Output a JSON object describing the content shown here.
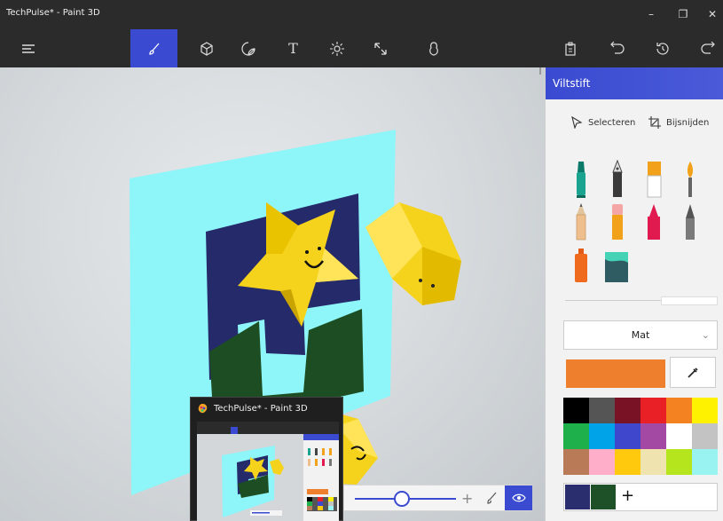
{
  "window": {
    "title": "TechPulse* - Paint 3D",
    "minimize": "–",
    "restore": "❐",
    "close": "✕"
  },
  "toolbar": {
    "menu_icon": "hamburger-icon",
    "tools": [
      {
        "name": "brushes",
        "icon": "brush-icon",
        "active": true
      },
      {
        "name": "3d-shapes",
        "icon": "cube-icon"
      },
      {
        "name": "stickers",
        "icon": "sticker-icon"
      },
      {
        "name": "text",
        "icon": "text-icon",
        "glyph": "T"
      },
      {
        "name": "effects",
        "icon": "sun-icon"
      },
      {
        "name": "canvas",
        "icon": "resize-icon"
      },
      {
        "name": "3d-library",
        "icon": "library-icon"
      }
    ],
    "right": [
      "paste-icon",
      "undo-icon",
      "history-icon",
      "redo-icon"
    ]
  },
  "panel": {
    "title": "Viltstift",
    "select_label": "Selecteren",
    "crop_label": "Bijsnijden",
    "brushes": [
      "marker",
      "calligraphy-pen",
      "oil-brush",
      "watercolor",
      "pencil",
      "eraser",
      "crayon",
      "pixel-pen",
      "spray-can",
      "fill"
    ],
    "finish_dropdown": "Mat",
    "current_color": "#ee7f2d",
    "palette": [
      "#000000",
      "#555555",
      "#7a1225",
      "#ea2027",
      "#f58220",
      "#fff200",
      "#1eb14b",
      "#00a2e8",
      "#3f48cc",
      "#a349a4",
      "#ffffff",
      "#c3c3c3",
      "#b97a57",
      "#ffaec9",
      "#ffc90e",
      "#efe4b0",
      "#b5e61d",
      "#99f3f0"
    ],
    "custom_colors": [
      "#2a2e6e",
      "#1e5128"
    ],
    "add_color": "+"
  },
  "zoom": {
    "plus": "+"
  },
  "thumbnail": {
    "title": "TechPulse* - Paint 3D"
  },
  "colors": {
    "accent": "#3a4bd1",
    "canvas_plate": "#8ef5f8",
    "navy": "#252a6b",
    "green": "#1d4d22",
    "star": "#f5d21b"
  }
}
